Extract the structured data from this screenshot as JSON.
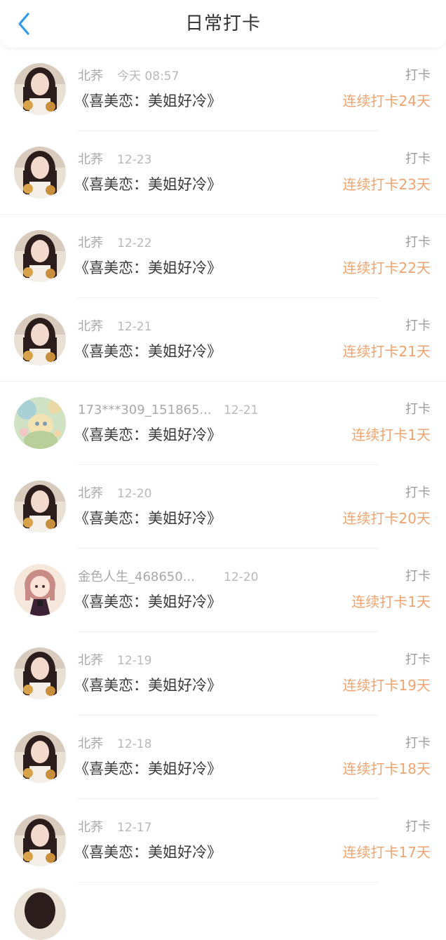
{
  "header": {
    "title": "日常打卡"
  },
  "colors": {
    "accent_back": "#2f9be8",
    "streak": "#f0a36e",
    "title": "#333333"
  },
  "rows": [
    {
      "name": "北荞",
      "date": "今天 08:57",
      "book": "《喜美恋：美姐好冷》",
      "action": "打卡",
      "streak": "连续打卡24天",
      "avatar": "portrait-avatar"
    },
    {
      "name": "北荞",
      "date": "12-23",
      "book": "《喜美恋：美姐好冷》",
      "action": "打卡",
      "streak": "连续打卡23天",
      "avatar": "portrait-avatar"
    },
    {
      "name": "北荞",
      "date": "12-22",
      "book": "《喜美恋：美姐好冷》",
      "action": "打卡",
      "streak": "连续打卡22天",
      "avatar": "portrait-avatar"
    },
    {
      "name": "北荞",
      "date": "12-21",
      "book": "《喜美恋：美姐好冷》",
      "action": "打卡",
      "streak": "连续打卡21天",
      "avatar": "portrait-avatar"
    },
    {
      "name": "173***309_151865...",
      "date": "12-21",
      "book": "《喜美恋：美姐好冷》",
      "action": "打卡",
      "streak": "连续打卡1天",
      "avatar": "illustration-avatar"
    },
    {
      "name": "北荞",
      "date": "12-20",
      "book": "《喜美恋：美姐好冷》",
      "action": "打卡",
      "streak": "连续打卡20天",
      "avatar": "portrait-avatar"
    },
    {
      "name": "金色人生_468650...",
      "date": "12-20",
      "book": "《喜美恋：美姐好冷》",
      "action": "打卡",
      "streak": "连续打卡1天",
      "avatar": "cartoon-girl-avatar"
    },
    {
      "name": "北荞",
      "date": "12-19",
      "book": "《喜美恋：美姐好冷》",
      "action": "打卡",
      "streak": "连续打卡19天",
      "avatar": "portrait-avatar"
    },
    {
      "name": "北荞",
      "date": "12-18",
      "book": "《喜美恋：美姐好冷》",
      "action": "打卡",
      "streak": "连续打卡18天",
      "avatar": "portrait-avatar"
    },
    {
      "name": "北荞",
      "date": "12-17",
      "book": "《喜美恋：美姐好冷》",
      "action": "打卡",
      "streak": "连续打卡17天",
      "avatar": "portrait-avatar"
    }
  ]
}
